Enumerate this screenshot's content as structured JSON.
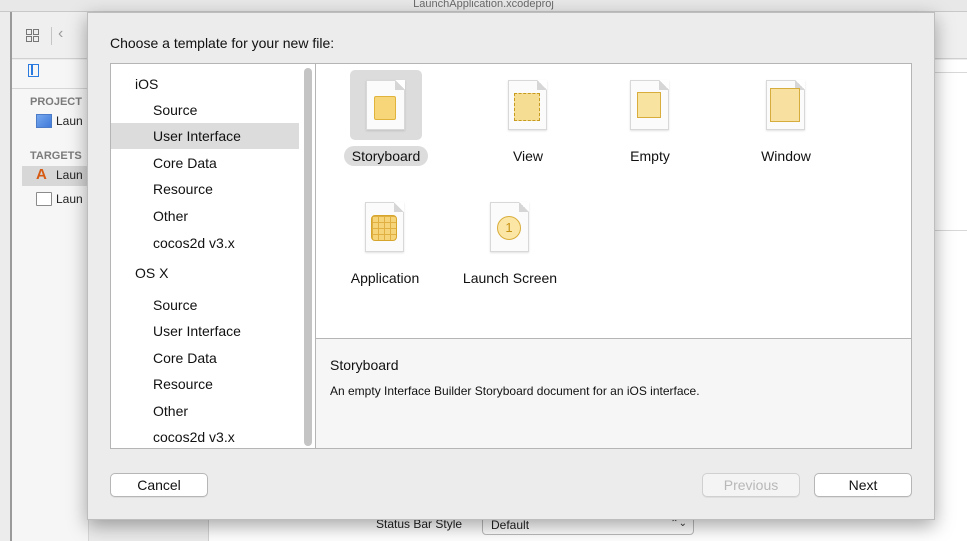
{
  "window": {
    "title": "LaunchApplication.xcodeproj"
  },
  "navigator": {
    "project_section": "PROJECT",
    "project_item": "Laun",
    "targets_section": "TARGETS",
    "target_items": [
      "Laun",
      "Laun"
    ]
  },
  "editor": {
    "status_bar_label": "Status Bar Style",
    "status_bar_value": "Default"
  },
  "sheet": {
    "title": "Choose a template for your new file:",
    "categories": {
      "ios": {
        "label": "iOS",
        "items": [
          "Source",
          "User Interface",
          "Core Data",
          "Resource",
          "Other",
          "cocos2d v3.x"
        ],
        "selected": "User Interface"
      },
      "osx": {
        "label": "OS X",
        "items": [
          "Source",
          "User Interface",
          "Core Data",
          "Resource",
          "Other",
          "cocos2d v3.x"
        ]
      }
    },
    "templates": [
      {
        "label": "Storyboard",
        "icon": "storyboard-icon",
        "selected": true
      },
      {
        "label": "View",
        "icon": "view-icon"
      },
      {
        "label": "Empty",
        "icon": "empty-icon"
      },
      {
        "label": "Window",
        "icon": "window-icon"
      },
      {
        "label": "Application",
        "icon": "application-icon"
      },
      {
        "label": "Launch Screen",
        "icon": "launch-screen-icon",
        "glyph": "1"
      }
    ],
    "description": {
      "title": "Storyboard",
      "text": "An empty Interface Builder Storyboard document for an iOS interface."
    },
    "buttons": {
      "cancel": "Cancel",
      "previous": "Previous",
      "next": "Next"
    }
  }
}
